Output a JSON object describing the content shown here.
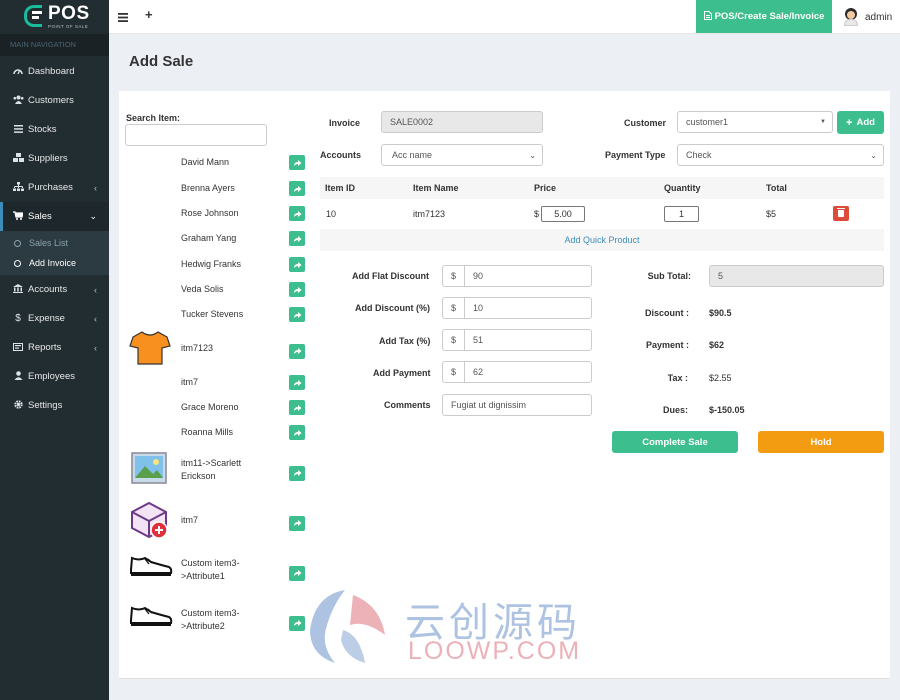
{
  "app": {
    "logo_title": "POS",
    "logo_subtitle": "POINT OF SALE"
  },
  "sidebar": {
    "header": "MAIN NAVIGATION",
    "items": [
      {
        "label": "Dashboard",
        "icon": "dashboard-icon"
      },
      {
        "label": "Customers",
        "icon": "users-icon"
      },
      {
        "label": "Stocks",
        "icon": "list-icon"
      },
      {
        "label": "Suppliers",
        "icon": "cubes-icon"
      },
      {
        "label": "Purchases",
        "icon": "sitemap-icon"
      },
      {
        "label": "Sales",
        "icon": "cart-icon"
      },
      {
        "label": "Accounts",
        "icon": "bank-icon"
      },
      {
        "label": "Expense",
        "icon": "dollar-icon"
      },
      {
        "label": "Reports",
        "icon": "report-icon"
      },
      {
        "label": "Employees",
        "icon": "user-icon"
      },
      {
        "label": "Settings",
        "icon": "gear-icon"
      }
    ],
    "sales_sub": [
      {
        "label": "Sales List"
      },
      {
        "label": "Add Invoice"
      }
    ]
  },
  "topbar": {
    "pos_button": "POS/Create Sale/Invoice",
    "user": "admin"
  },
  "page": {
    "title": "Add Sale"
  },
  "search": {
    "label": "Search Item:",
    "value": ""
  },
  "items": [
    {
      "name": "David Mann"
    },
    {
      "name": "Brenna Ayers"
    },
    {
      "name": "Rose Johnson"
    },
    {
      "name": "Graham Yang"
    },
    {
      "name": "Hedwig Franks"
    },
    {
      "name": "Veda Solis"
    },
    {
      "name": "Tucker Stevens"
    },
    {
      "name": "itm7123",
      "image": "tshirt-icon"
    },
    {
      "name": "itm7"
    },
    {
      "name": "Grace Moreno"
    },
    {
      "name": "Roanna Mills"
    },
    {
      "name": "itm11->Scarlett Erickson",
      "image": "picture-icon"
    },
    {
      "name": "itm7",
      "image": "box-add-icon"
    },
    {
      "name": "Custom item3->Attribute1",
      "image": "shoe-icon"
    },
    {
      "name": "Custom item3->Attribute2",
      "image": "shoe-icon"
    }
  ],
  "invoice": {
    "label": "Invoice",
    "value": "SALE0002"
  },
  "accounts": {
    "label": "Accounts",
    "value": "Acc name"
  },
  "customer": {
    "label": "Customer",
    "value": "customer1",
    "add_label": "Add"
  },
  "payment_type": {
    "label": "Payment Type",
    "value": "Check"
  },
  "table": {
    "headers": [
      "Item ID",
      "Item Name",
      "Price",
      "Quantity",
      "Total"
    ],
    "rows": [
      {
        "id": "10",
        "name": "itm7123",
        "currency": "$",
        "price": "5.00",
        "qty": "1",
        "total": "$5"
      }
    ],
    "quick_add": "Add Quick Product"
  },
  "adjustments": {
    "flat_discount": {
      "label": "Add Flat Discount",
      "prefix": "$",
      "value": "90"
    },
    "discount_pct": {
      "label": "Add Discount (%)",
      "prefix": "$",
      "value": "10"
    },
    "tax_pct": {
      "label": "Add Tax (%)",
      "prefix": "$",
      "value": "51"
    },
    "payment": {
      "label": "Add Payment",
      "prefix": "$",
      "value": "62"
    },
    "comments": {
      "label": "Comments",
      "value": "Fugiat ut dignissim"
    }
  },
  "summary": {
    "subtotal": {
      "label": "Sub Total:",
      "value": "5"
    },
    "discount": {
      "label": "Discount :",
      "value": "$90.5"
    },
    "payment": {
      "label": "Payment :",
      "value": "$62"
    },
    "tax": {
      "label": "Tax :",
      "value": "$2.55"
    },
    "dues": {
      "label": "Dues:",
      "value": "$-150.05"
    }
  },
  "actions": {
    "complete": "Complete Sale",
    "hold": "Hold"
  },
  "watermark": {
    "cn": "云创源码",
    "en": "LOOWP.COM"
  },
  "colors": {
    "sidebar": "#222d32",
    "accent": "#3dbe8f",
    "hold": "#f39c12",
    "delete": "#dd4b39",
    "link": "#3c8dbc"
  }
}
